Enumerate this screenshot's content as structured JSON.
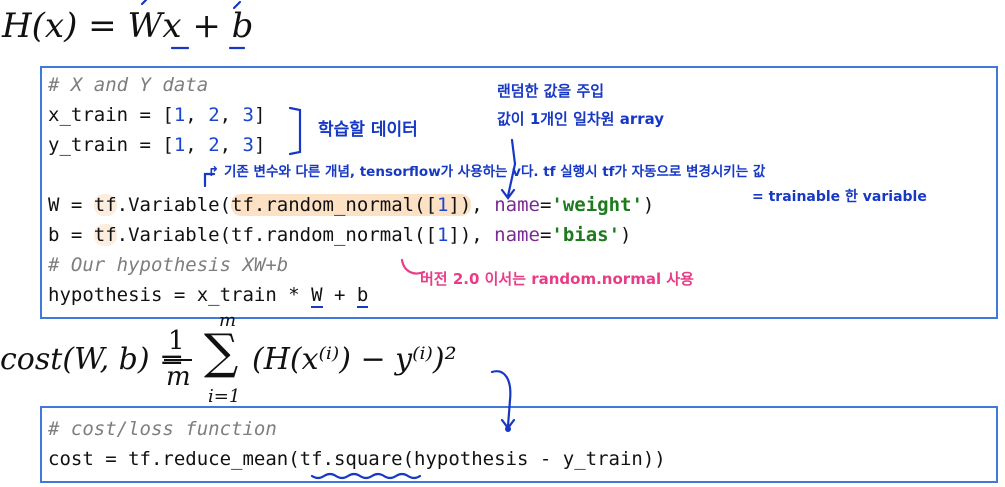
{
  "formulas": {
    "hypothesis": "H(x) = Wx + b",
    "cost_lhs": "cost(W, b) =",
    "cost_frac_num": "1",
    "cost_frac_den": "m",
    "cost_sum_top": "m",
    "cost_sum_bottom": "i=1",
    "cost_body": "(H(x⁽ⁱ⁾) − y⁽ⁱ⁾)²"
  },
  "code_block_1": {
    "lines": [
      "# X and Y data",
      "x_train = [1, 2, 3]",
      "y_train = [1, 2, 3]",
      "",
      "W = tf.Variable(tf.random_normal([1]), name='weight')",
      "b = tf.Variable(tf.random_normal([1]), name='bias')",
      "# Our hypothesis XW+b",
      "hypothesis = x_train * W + b"
    ]
  },
  "code_block_2": {
    "lines": [
      "# cost/loss function",
      "cost = tf.reduce_mean(tf.square(hypothesis - y_train))"
    ]
  },
  "annotations": {
    "training_data": "학습할 데이터",
    "random_value_1": "랜덤한 값을 주입",
    "random_value_2": "값이 1개인 일차원 array",
    "variable_note": "↱ 기존 변수와 다른 개념, tensorflow가 사용하는 v다. tf 실행시 tf가 자동으로 변경시키는 값",
    "trainable_note": "= trainable 한 variable",
    "version_note": "버전 2.0 이서는  random.normal 사용"
  },
  "colors": {
    "box_border": "#3f79d9",
    "annotation_blue": "#1638c4",
    "annotation_pink": "#e83d86",
    "highlight": "#fac896"
  }
}
